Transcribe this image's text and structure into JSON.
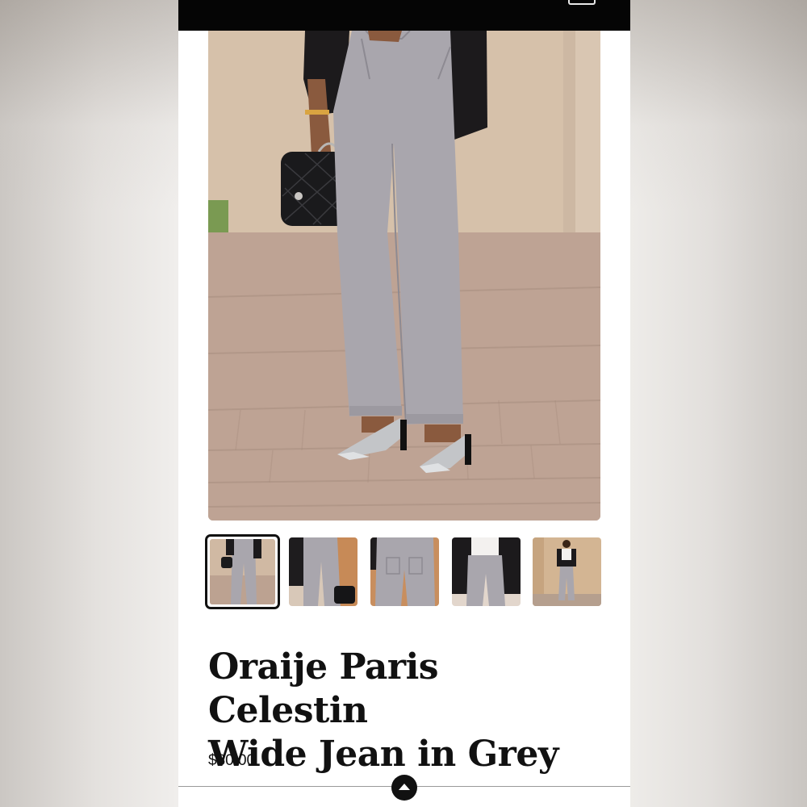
{
  "product": {
    "title_line1": "Oraije Paris Celestin",
    "title_line2": "Wide Jean in Grey",
    "price": "$80.00"
  },
  "gallery": {
    "main_image": "grey-wide-jeans-hero-photo",
    "thumbnails": [
      {
        "name": "thumbnail-1",
        "selected": true
      },
      {
        "name": "thumbnail-2",
        "selected": false
      },
      {
        "name": "thumbnail-3",
        "selected": false
      },
      {
        "name": "thumbnail-4",
        "selected": false
      },
      {
        "name": "thumbnail-5",
        "selected": false
      }
    ]
  },
  "icons": {
    "menu": "menu-icon",
    "scroll_top": "chevron-up-icon"
  },
  "colors": {
    "header": "#050505",
    "text": "#111111",
    "denim": "#a9a6ad"
  }
}
